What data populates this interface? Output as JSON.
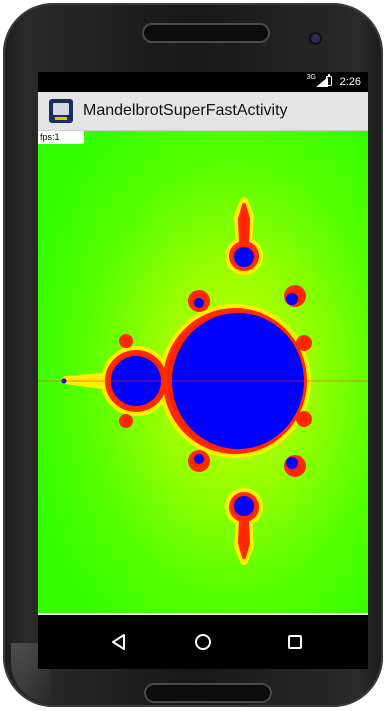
{
  "status_bar": {
    "network_label": "3G",
    "time": "2:26",
    "icons": [
      "signal-icon",
      "battery-icon"
    ]
  },
  "app_bar": {
    "title": "MandelbrotSuperFastActivity",
    "icon": "app-launcher-icon"
  },
  "content": {
    "fps_label": "fps:1",
    "colors": {
      "background": "#33ff00",
      "set_fill": "#0000ff",
      "edge": "#ff3300",
      "halo": "#ffff00"
    }
  },
  "nav_bar": {
    "buttons": [
      "back-icon",
      "home-icon",
      "recents-icon"
    ]
  }
}
